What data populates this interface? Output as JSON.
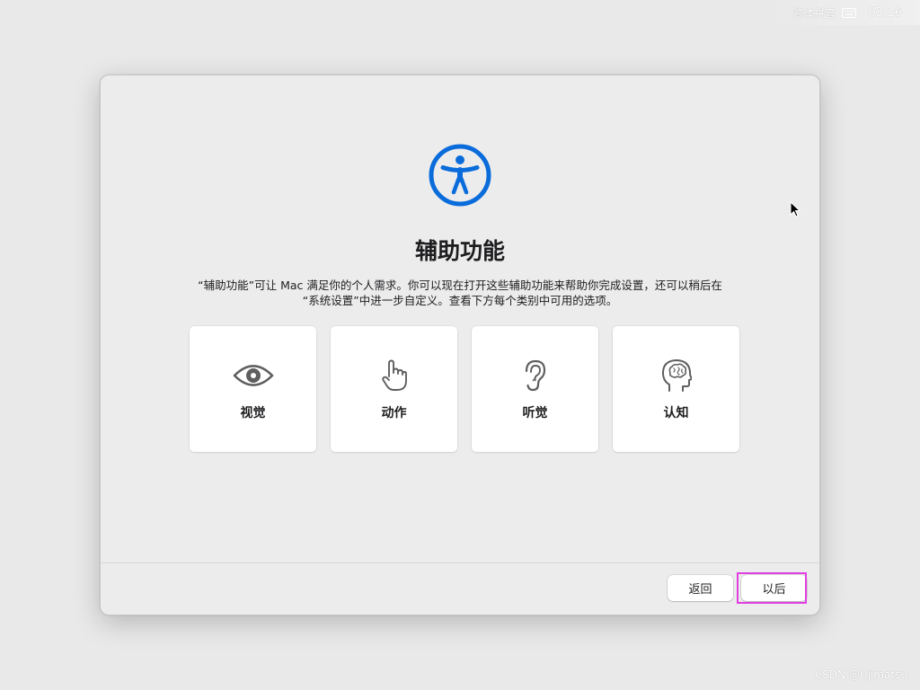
{
  "menubar": {
    "input_source": "简体拼音",
    "input_icon": "keyboard-icon",
    "clock": "03:16"
  },
  "dialog": {
    "hero_icon": "accessibility-icon",
    "title": "辅助功能",
    "description_line1": "“辅助功能”可让 Mac 满足你的个人需求。你可以现在打开这些辅助功能来帮助你完成设置，还可以稍后在",
    "description_line2": "“系统设置”中进一步自定义。查看下方每个类别中可用的选项。",
    "cards": [
      {
        "label": "视觉",
        "icon": "eye-icon"
      },
      {
        "label": "动作",
        "icon": "pointing-hand-icon"
      },
      {
        "label": "听觉",
        "icon": "ear-icon"
      },
      {
        "label": "认知",
        "icon": "brain-head-icon"
      }
    ],
    "buttons": {
      "back": "返回",
      "later": "以后"
    }
  },
  "watermark": "CSDN @Ujimatsu",
  "colors": {
    "accent_blue": "#0a6cdb",
    "highlight_magenta": "#e040e0",
    "background": "#e9e9e9",
    "window": "#ececec"
  }
}
